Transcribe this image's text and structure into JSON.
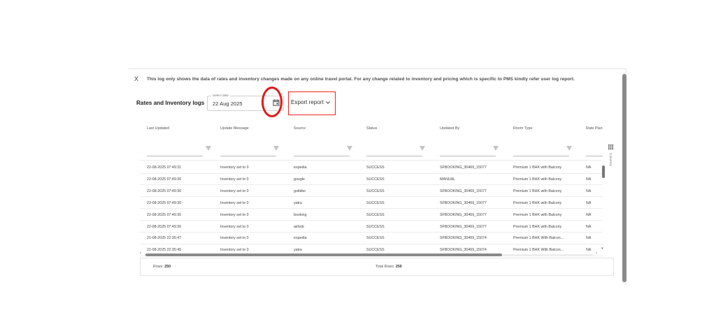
{
  "notice": {
    "close_label": "X",
    "text": "This log only shows the data of rates and inventory changes made on any online travel portal. For any change related to inventory and pricing which is specific to PMS kindly refer user log report."
  },
  "header": {
    "title": "Rates and Inventory logs",
    "date_label": "Select date",
    "date_value": "22 Aug 2025",
    "export_label": "Export report"
  },
  "table": {
    "columns": [
      "Last Updated",
      "Update Message",
      "Source",
      "Status",
      "Updated By",
      "Room Type",
      "Rate Plan"
    ],
    "rows": [
      [
        "22-08-2025 07:49:31",
        "Inventory set to 0",
        "expedia",
        "SUCCESS",
        "SFBOOKING_30469_15077",
        "Premium 1 BHK with Balcony",
        "NA"
      ],
      [
        "22-08-2025 07:49:30",
        "Inventory set to 0",
        "google",
        "SUCCESS",
        "MANUAL",
        "Premium 1 BHK with Balcony",
        "NA"
      ],
      [
        "22-08-2025 07:49:30",
        "Inventory set to 0",
        "goibibo",
        "SUCCESS",
        "SFBOOKING_30469_15077",
        "Premium 1 BHK with Balcony",
        "NA"
      ],
      [
        "22-08-2025 07:49:30",
        "Inventory set to 0",
        "yatra",
        "SUCCESS",
        "SFBOOKING_30469_15077",
        "Premium 1 BHK with Balcony",
        "NA"
      ],
      [
        "22-08-2025 07:49:30",
        "Inventory set to 0",
        "booking",
        "SUCCESS",
        "SFBOOKING_30469_15077",
        "Premium 1 BHK with Balcony",
        "NA"
      ],
      [
        "22-08-2025 07:49:30",
        "Inventory set to 0",
        "airbnb",
        "SUCCESS",
        "SFBOOKING_30469_15077",
        "Premium 1 BHK with Balcony",
        "NA"
      ],
      [
        "21-08-2025 22:35:47",
        "Inventory set to 0",
        "expedia",
        "SUCCESS",
        "SFBOOKING_30469_15074",
        "Premium 1 BHK With Balcon...",
        "NA"
      ],
      [
        "21-08-2025 22:35:45",
        "Inventory set to 0",
        "yatra",
        "SUCCESS",
        "SFBOOKING_30469_15074",
        "Premium 1 BHK With Balcon...",
        "NA"
      ]
    ],
    "columns_tool_label": "Columns"
  },
  "footer": {
    "rows_label": "Rows:",
    "rows_value": "250",
    "total_label": "Total Rows:",
    "total_value": "250"
  },
  "colors": {
    "highlight": "#e11818"
  },
  "icons": {
    "calendar": "calendar-icon",
    "filter": "filter-icon",
    "chevron": "chevron-down-icon",
    "columns": "columns-grid-icon"
  }
}
